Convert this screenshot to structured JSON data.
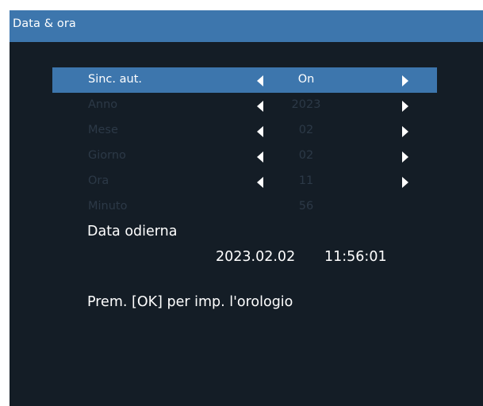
{
  "window": {
    "title": "Data & ora"
  },
  "settings": [
    {
      "label": "Sinc. aut.",
      "value": "On",
      "selected": true,
      "arrows": true
    },
    {
      "label": "Anno",
      "value": "2023",
      "selected": false,
      "arrows": true
    },
    {
      "label": "Mese",
      "value": "02",
      "selected": false,
      "arrows": true
    },
    {
      "label": "Giorno",
      "value": "02",
      "selected": false,
      "arrows": true
    },
    {
      "label": "Ora",
      "value": "11",
      "selected": false,
      "arrows": true
    },
    {
      "label": "Minuto",
      "value": "56",
      "selected": false,
      "arrows": false
    }
  ],
  "current": {
    "label": "Data odierna",
    "date": "2023.02.02",
    "time": "11:56:01"
  },
  "hint": "Prem. [OK] per imp. l'orologio",
  "colors": {
    "accent": "#3d76ad",
    "background": "#141d26",
    "disabled_text": "#2c3947",
    "text": "#ffffff"
  }
}
